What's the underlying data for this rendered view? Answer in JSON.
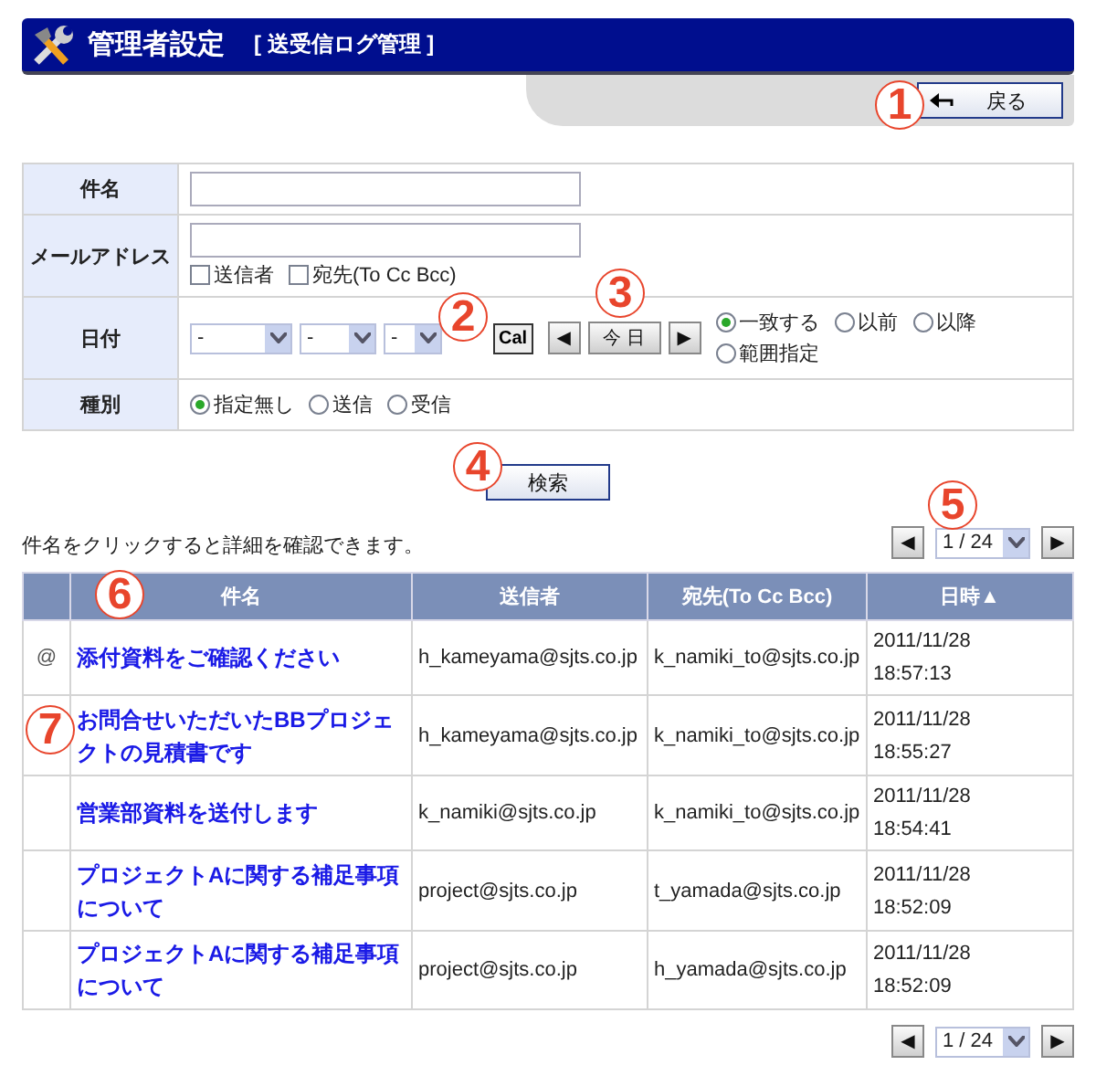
{
  "header": {
    "title": "管理者設定",
    "subtitle": "[ 送受信ログ管理 ]"
  },
  "back_button": {
    "label": "戻る"
  },
  "form": {
    "subject": {
      "label": "件名"
    },
    "address": {
      "label": "メールアドレス",
      "checks": [
        {
          "label": "送信者",
          "checked": false
        },
        {
          "label": "宛先(To Cc Bcc)",
          "checked": false
        }
      ]
    },
    "date": {
      "label": "日付",
      "selects": [
        "-",
        "-",
        "-"
      ],
      "cal_button": "Cal",
      "prev": "◀",
      "today": "今 日",
      "next": "▶",
      "options": [
        {
          "label": "一致する",
          "selected": true
        },
        {
          "label": "以前",
          "selected": false
        },
        {
          "label": "以降",
          "selected": false
        },
        {
          "label": "範囲指定",
          "selected": false
        }
      ]
    },
    "type": {
      "label": "種別",
      "options": [
        {
          "label": "指定無し",
          "selected": true
        },
        {
          "label": "送信",
          "selected": false
        },
        {
          "label": "受信",
          "selected": false
        }
      ]
    }
  },
  "search_button": "検索",
  "hint": "件名をクリックすると詳細を確認できます。",
  "pagination_top": {
    "prev": "◀",
    "page": "1 / 24",
    "next": "▶"
  },
  "table": {
    "columns": [
      null,
      "件名",
      "送信者",
      "宛先(To Cc Bcc)",
      "日時▲"
    ],
    "rows": [
      {
        "mark": "@",
        "subject": "添付資料をご確認ください",
        "sender": "h_kameyama@sjts.co.jp",
        "to": "k_namiki_to@sjts.co.jp",
        "date": "2011/11/28",
        "time": "18:57:13"
      },
      {
        "subject": "お問合せいただいたBBプロジェクトの見積書です",
        "sender": "h_kameyama@sjts.co.jp",
        "to": "k_namiki_to@sjts.co.jp",
        "date": "2011/11/28",
        "time": "18:55:27"
      },
      {
        "subject": "営業部資料を送付します",
        "sender": "k_namiki@sjts.co.jp",
        "to": "k_namiki_to@sjts.co.jp",
        "date": "2011/11/28",
        "time": "18:54:41"
      },
      {
        "subject": "プロジェクトAに関する補足事項について",
        "sender": "project@sjts.co.jp",
        "to": "t_yamada@sjts.co.jp",
        "date": "2011/11/28",
        "time": "18:52:09"
      },
      {
        "subject": "プロジェクトAに関する補足事項について",
        "sender": "project@sjts.co.jp",
        "to": "h_yamada@sjts.co.jp",
        "date": "2011/11/28",
        "time": "18:52:09"
      }
    ]
  },
  "pagination_bottom": {
    "prev": "◀",
    "page": "1 / 24",
    "next": "▶"
  },
  "callouts": [
    "1",
    "2",
    "3",
    "4",
    "5",
    "6",
    "7"
  ]
}
